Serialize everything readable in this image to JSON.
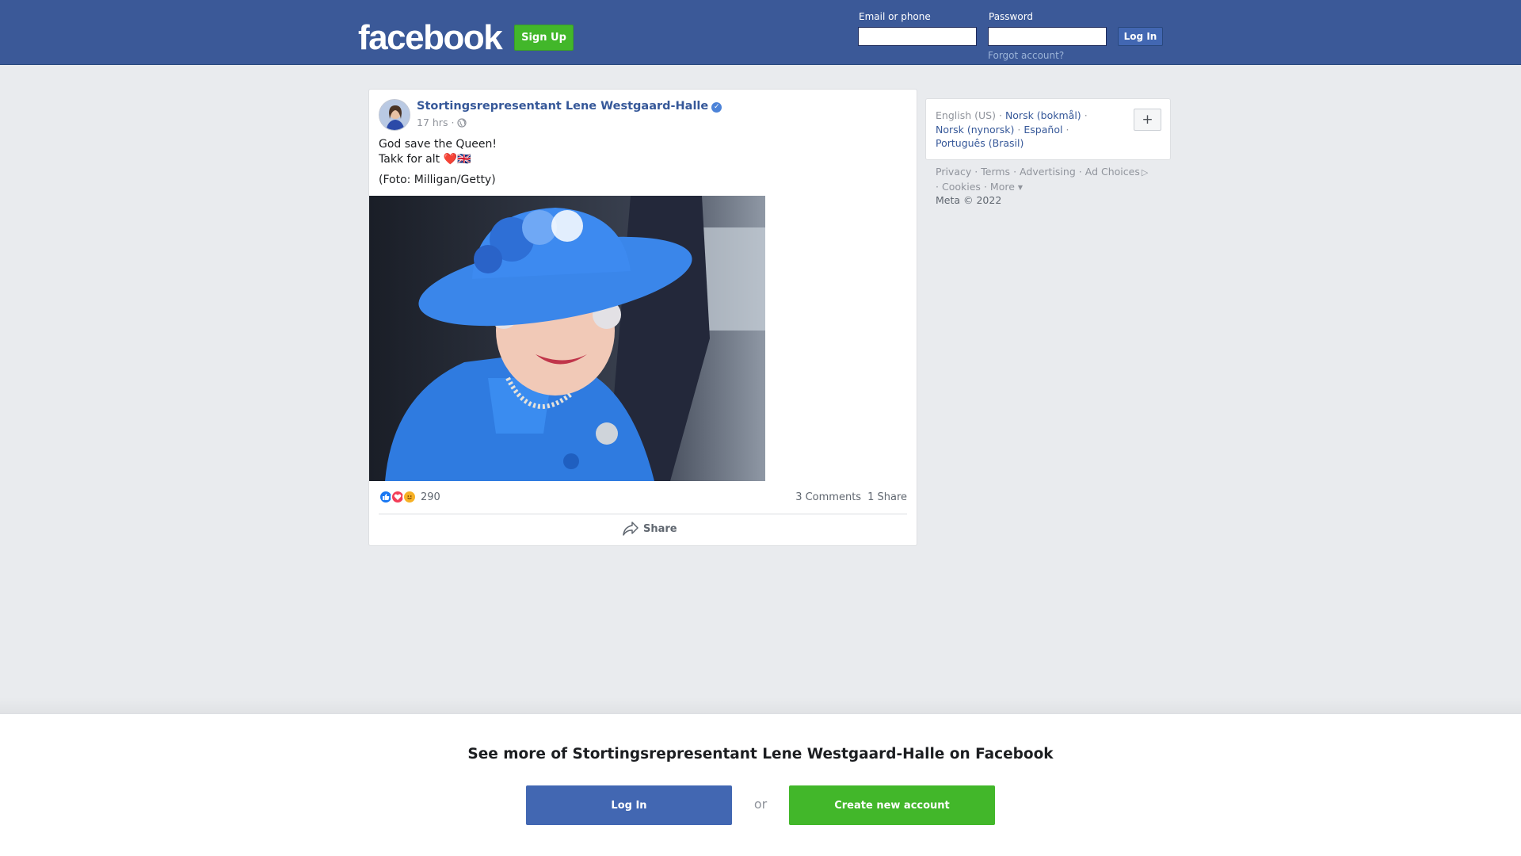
{
  "header": {
    "logo": "facebook",
    "signup_label": "Sign Up",
    "email_label": "Email or phone",
    "password_label": "Password",
    "login_label": "Log In",
    "forgot_label": "Forgot account?"
  },
  "post": {
    "author": "Stortingsrepresentant Lene Westgaard-Halle",
    "time": "17 hrs",
    "text_line1": "God save the Queen!",
    "text_line2": "Takk for alt",
    "text_emoji": "❤️",
    "flag": "🇬🇧",
    "caption": "(Foto: Milligan/Getty)",
    "reaction_count": "290",
    "comments": "3 Comments",
    "shares": "1 Share",
    "share_label": "Share"
  },
  "languages": {
    "current": "English (US)",
    "items": [
      "Norsk (bokmål)",
      "Norsk (nynorsk)",
      "Español",
      "Português (Brasil)"
    ],
    "more_button": "+"
  },
  "footer": {
    "links": [
      "Privacy",
      "Terms",
      "Advertising",
      "Ad Choices",
      "Cookies",
      "More"
    ],
    "copyright": "Meta © 2022"
  },
  "banner": {
    "title": "See more of Stortingsrepresentant Lene Westgaard-Halle on Facebook",
    "login_label": "Log In",
    "or_label": "or",
    "create_label": "Create new account"
  },
  "colors": {
    "brand_blue": "#3b5998",
    "button_blue": "#4267b2",
    "signup_green": "#42b72a",
    "link_blue": "#365899"
  }
}
